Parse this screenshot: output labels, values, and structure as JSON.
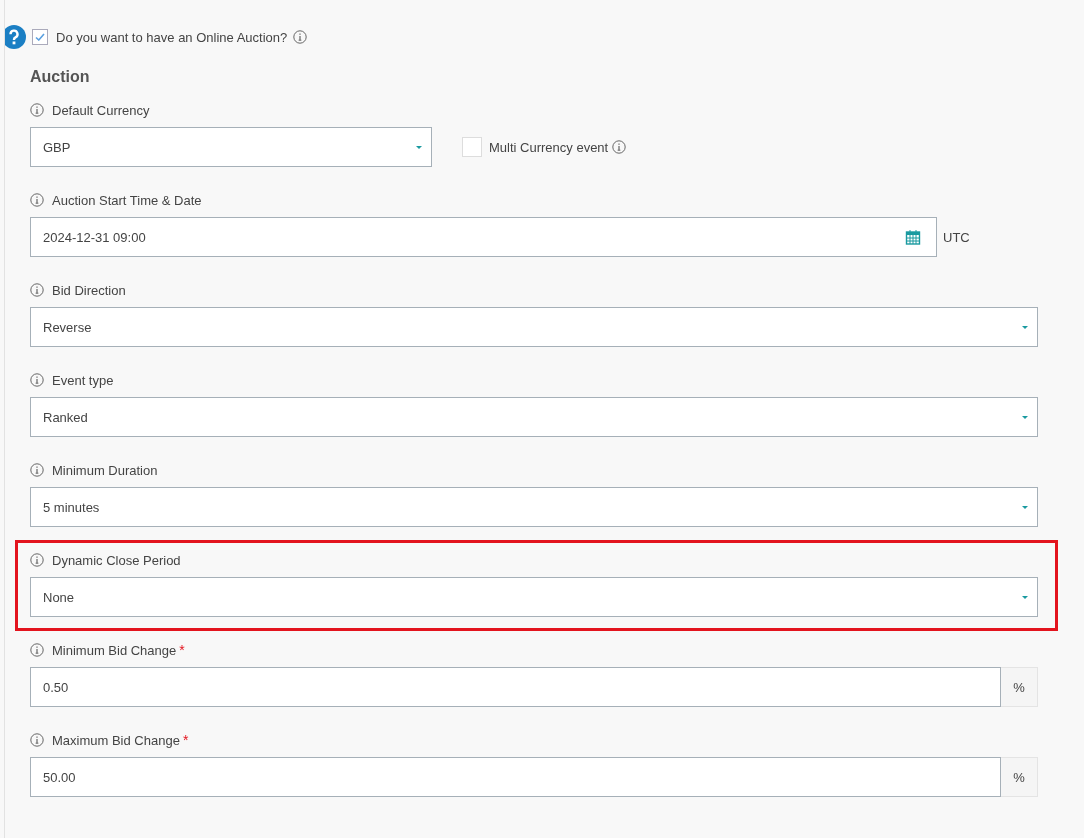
{
  "online_auction": {
    "label": "Do you want to have an Online Auction?",
    "checked": true
  },
  "section_title": "Auction",
  "fields": [
    {
      "kind": "select_with_checkbox",
      "label": "Default Currency",
      "value": "GBP",
      "checkbox": {
        "label": "Multi Currency event",
        "checked": false
      }
    },
    {
      "kind": "date",
      "label": "Auction Start Time & Date",
      "value": "2024-12-31 09:00",
      "suffix": "UTC"
    },
    {
      "kind": "select",
      "label": "Bid Direction",
      "value": "Reverse"
    },
    {
      "kind": "select",
      "label": "Event type",
      "value": "Ranked"
    },
    {
      "kind": "select",
      "label": "Minimum Duration",
      "value": "5 minutes"
    },
    {
      "kind": "select",
      "label": "Dynamic Close Period",
      "value": "None",
      "highlighted": true
    },
    {
      "kind": "addon",
      "label": "Minimum Bid Change",
      "required_mark": "*",
      "value": "0.50",
      "addon": "%"
    },
    {
      "kind": "addon",
      "label": "Maximum Bid Change",
      "required_mark": "*",
      "value": "50.00",
      "addon": "%"
    }
  ]
}
